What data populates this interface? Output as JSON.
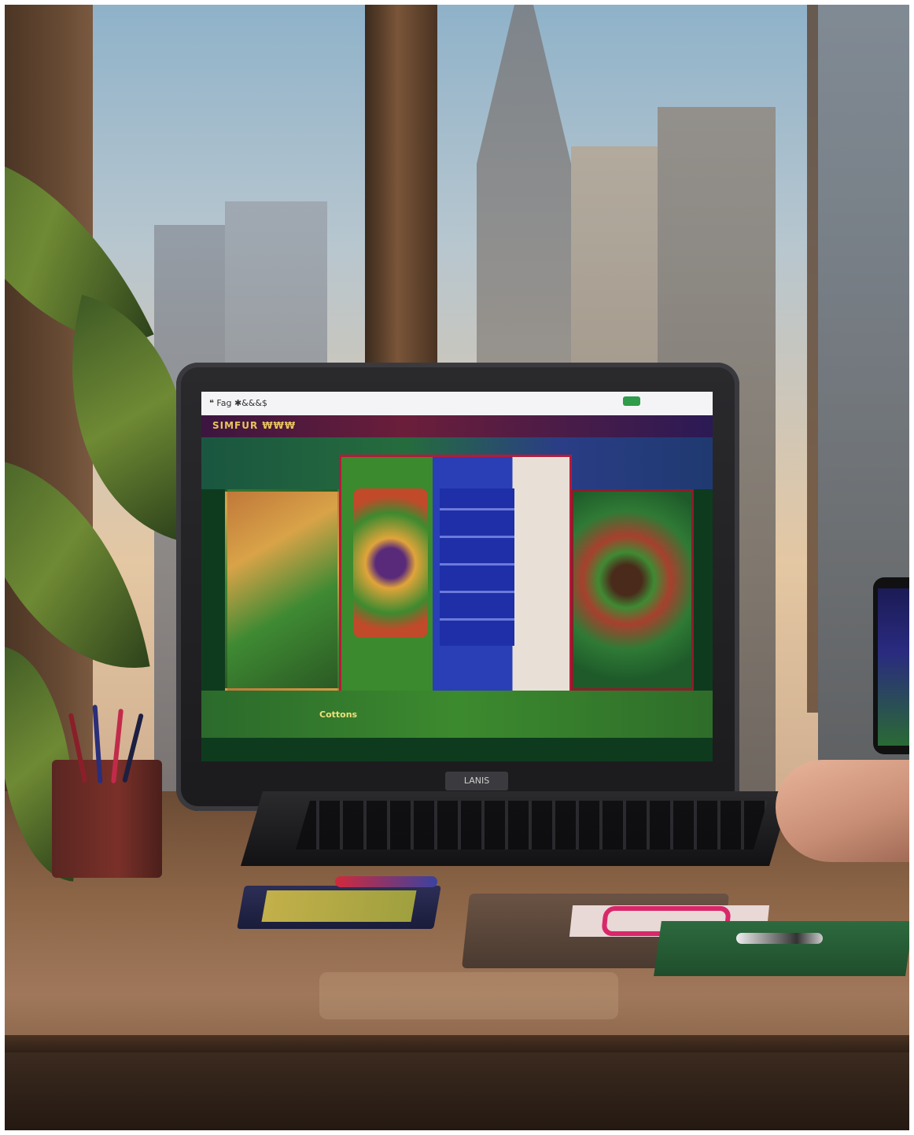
{
  "scene": {
    "description_tags": [
      "laptop",
      "city-window",
      "plant",
      "desk",
      "phone",
      "notebook",
      "pen-cup"
    ]
  },
  "laptop": {
    "browser_url": "  ❝ Fag  ✱&&&$",
    "site_logo": "SIMFUR ₩₩₩",
    "bottom_label": "Cottons",
    "brand": "LANIS"
  },
  "colors": {
    "screen_green": "#2b6a2c",
    "nav_purple": "#3b1640",
    "accent_red": "#b8193a",
    "sky": "#b7c6cf",
    "desk": "#8b6446"
  }
}
